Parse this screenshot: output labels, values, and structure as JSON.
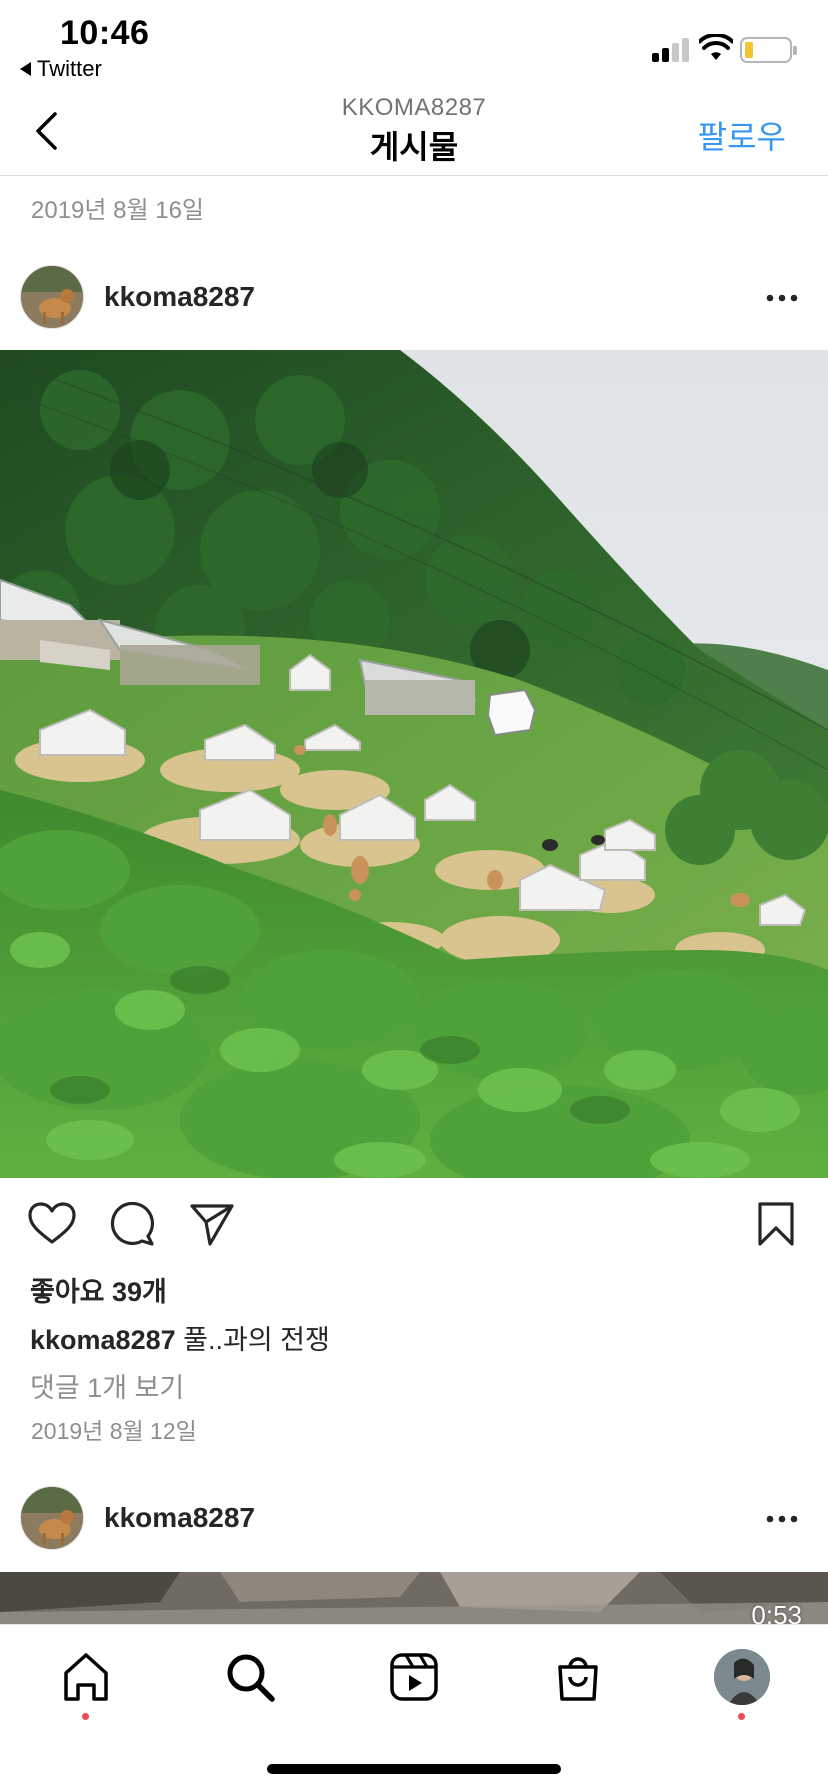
{
  "status_bar": {
    "time": "10:46",
    "back_app": "Twitter"
  },
  "header": {
    "username": "KKOMA8287",
    "title": "게시물",
    "follow": "팔로우"
  },
  "prev_post_date": "2019년 8월 16일",
  "post": {
    "username": "kkoma8287",
    "likes": "좋아요 39개",
    "caption_user": "kkoma8287",
    "caption_text": "풀..과의 전쟁",
    "comments": "댓글 1개 보기",
    "date": "2019년 8월 12일"
  },
  "next_post": {
    "username": "kkoma8287",
    "duration": "0:53"
  },
  "icons": [
    "back-chevron-icon",
    "more-icon",
    "heart-icon",
    "comment-icon",
    "send-icon",
    "bookmark-icon",
    "home-icon",
    "search-icon",
    "reels-icon",
    "shop-icon",
    "profile-avatar"
  ],
  "colors": {
    "accent": "#3897f0",
    "notification_dot": "#ed4956",
    "secondary_text": "#8e8e8e"
  }
}
